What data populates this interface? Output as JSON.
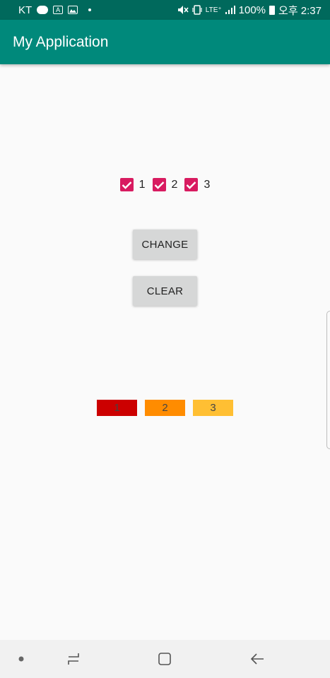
{
  "status_bar": {
    "carrier": "KT",
    "icon_badge": "A",
    "network": "LTE⁺",
    "battery": "100%",
    "time": "오후 2:37"
  },
  "app_bar": {
    "title": "My Application"
  },
  "checkboxes": [
    {
      "label": "1",
      "checked": true
    },
    {
      "label": "2",
      "checked": true
    },
    {
      "label": "3",
      "checked": true
    }
  ],
  "buttons": {
    "change": "CHANGE",
    "clear": "CLEAR"
  },
  "color_boxes": [
    {
      "label": "1",
      "color": "#cc0000"
    },
    {
      "label": "2",
      "color": "#ff8c00"
    },
    {
      "label": "3",
      "color": "#ffbf33"
    }
  ],
  "colors": {
    "status_bar": "#00695c",
    "app_bar": "#00897b",
    "checkbox_accent": "#d81b60",
    "button_bg": "#d6d7d7"
  }
}
